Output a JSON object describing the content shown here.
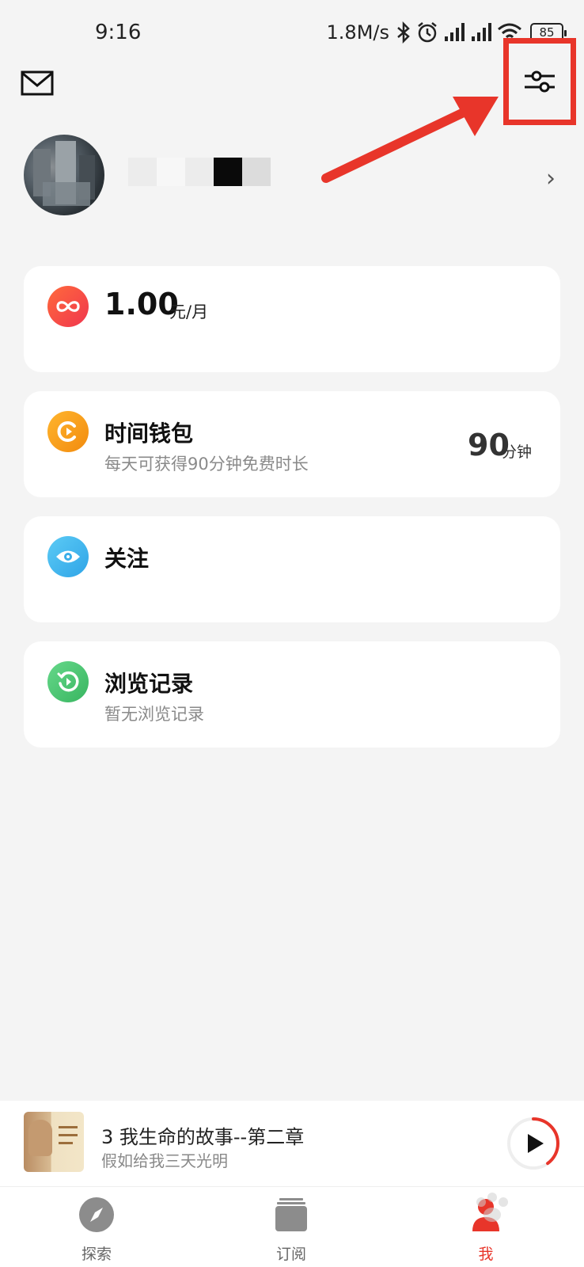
{
  "status_bar": {
    "time": "9:16",
    "net_speed": "1.8M/s",
    "battery": "85"
  },
  "profile": {
    "chevron": "›"
  },
  "membership": {
    "price": "1.00",
    "unit": "元/月",
    "icon": "infinity-icon",
    "icon_color": "#f0364e"
  },
  "time_wallet": {
    "title": "时间钱包",
    "subtitle": "每天可获得90分钟免费时长",
    "minutes": "90",
    "minutes_unit": "分钟",
    "icon_color": "#f7a21b"
  },
  "follow": {
    "title": "关注",
    "icon_color": "#3fb2ea"
  },
  "history": {
    "title": "浏览记录",
    "subtitle": "暂无浏览记录",
    "icon_color": "#49c46d"
  },
  "mini_player": {
    "title": "3 我生命的故事--第二章",
    "subtitle": "假如给我三天光明",
    "progress": 0.4
  },
  "tabs": [
    {
      "label": "探索",
      "icon": "compass-icon",
      "active": false
    },
    {
      "label": "订阅",
      "icon": "stack-icon",
      "active": false
    },
    {
      "label": "我",
      "icon": "person-icon",
      "active": true
    }
  ],
  "accent_color": "#e8352a"
}
